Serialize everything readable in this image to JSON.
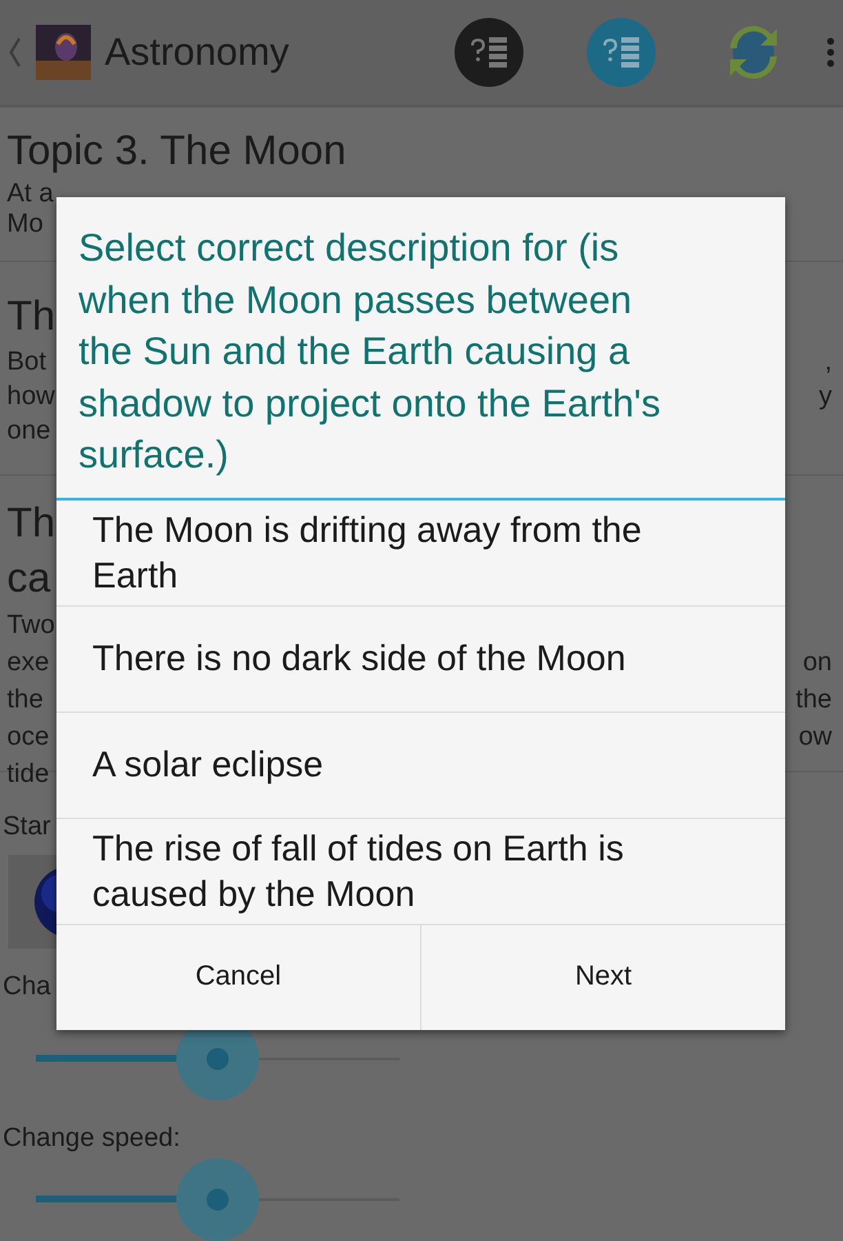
{
  "action_bar": {
    "title": "Astronomy"
  },
  "sections": [
    {
      "title_lines": [
        "Topic 3. The Moon"
      ],
      "lines": [
        {
          "left": "At a"
        },
        {
          "left": "Mo"
        }
      ]
    },
    {
      "title_lines": [
        "Th"
      ],
      "lines": [
        {
          "left": "Bot",
          "right": ","
        },
        {
          "left": "how",
          "right": "y"
        },
        {
          "left": "one"
        }
      ]
    },
    {
      "title_lines": [
        "Th",
        "ca"
      ],
      "lines": [
        {
          "left": "Two"
        },
        {
          "left": "exe",
          "right": "on"
        },
        {
          "left": "the",
          "right": "the"
        },
        {
          "left": "oce",
          "right": "ow"
        },
        {
          "left": "tide"
        }
      ]
    }
  ],
  "controls": [
    {
      "kind": "label",
      "text": "Star"
    },
    {
      "kind": "picture"
    },
    {
      "kind": "label",
      "text": "Cha"
    },
    {
      "kind": "slider",
      "level": 0.5
    },
    {
      "kind": "label",
      "text": "Change speed:"
    },
    {
      "kind": "slider",
      "level": 0.5
    }
  ],
  "dialog": {
    "title": "Select correct description for (is when the Moon passes between the Sun and the Earth causing a shadow to project onto the Earth's surface.)",
    "options": [
      "The Moon is drifting away from the Earth",
      "There is no dark side of the Moon",
      "A solar eclipse",
      "The rise of fall of tides on Earth is caused by the Moon"
    ],
    "buttons": [
      "Cancel",
      "Next"
    ]
  }
}
